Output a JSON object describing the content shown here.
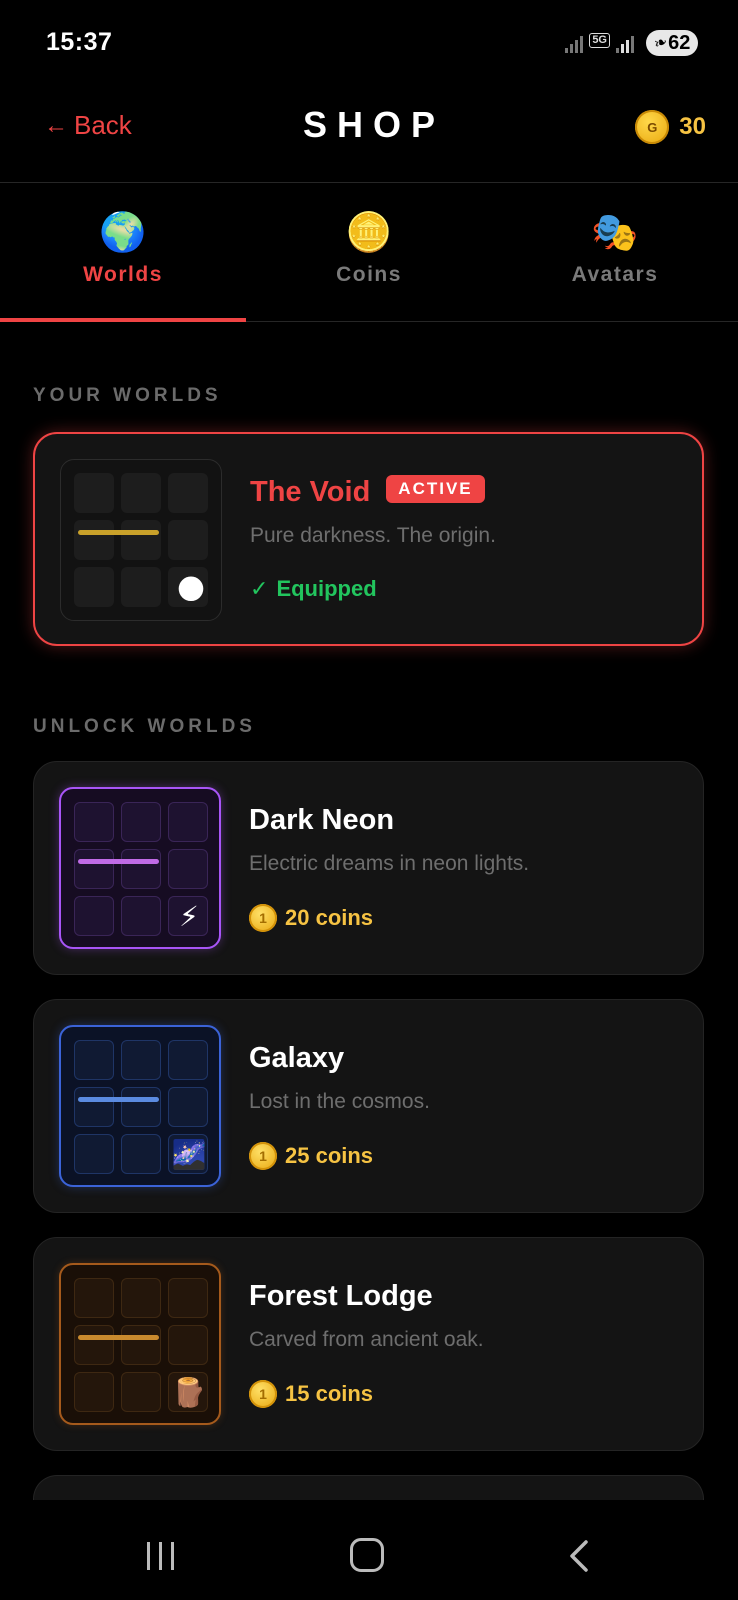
{
  "status_bar": {
    "time": "15:37",
    "network": "5G",
    "battery": "62"
  },
  "header": {
    "back_label": "Back",
    "title": "SHOP",
    "coin_symbol": "G",
    "coin_balance": "30"
  },
  "tabs": [
    {
      "label": "Worlds",
      "icon": "🌍",
      "active": true
    },
    {
      "label": "Coins",
      "icon": "🪙",
      "active": false
    },
    {
      "label": "Avatars",
      "icon": "🎭",
      "active": false
    }
  ],
  "your_worlds": {
    "heading": "YOUR WORLDS",
    "items": [
      {
        "title": "The Void",
        "badge": "ACTIVE",
        "description": "Pure darkness. The origin.",
        "status": "Equipped",
        "status_mark": "✓",
        "mini_icon": "🌑"
      }
    ]
  },
  "unlock_worlds": {
    "heading": "UNLOCK WORLDS",
    "items": [
      {
        "title": "Dark Neon",
        "description": "Electric dreams in neon lights.",
        "price": "20 coins",
        "mini_icon": "⚡"
      },
      {
        "title": "Galaxy",
        "description": "Lost in the cosmos.",
        "price": "25 coins",
        "mini_icon": "🌌"
      },
      {
        "title": "Forest Lodge",
        "description": "Carved from ancient oak.",
        "price": "15 coins",
        "mini_icon": "🪵"
      }
    ]
  },
  "colors": {
    "accent": "#ef4444",
    "coin": "#f6c343",
    "equipped": "#22c55e",
    "neon": "#a855f7",
    "galaxy": "#3b63d8",
    "forest": "#a55a1c"
  }
}
